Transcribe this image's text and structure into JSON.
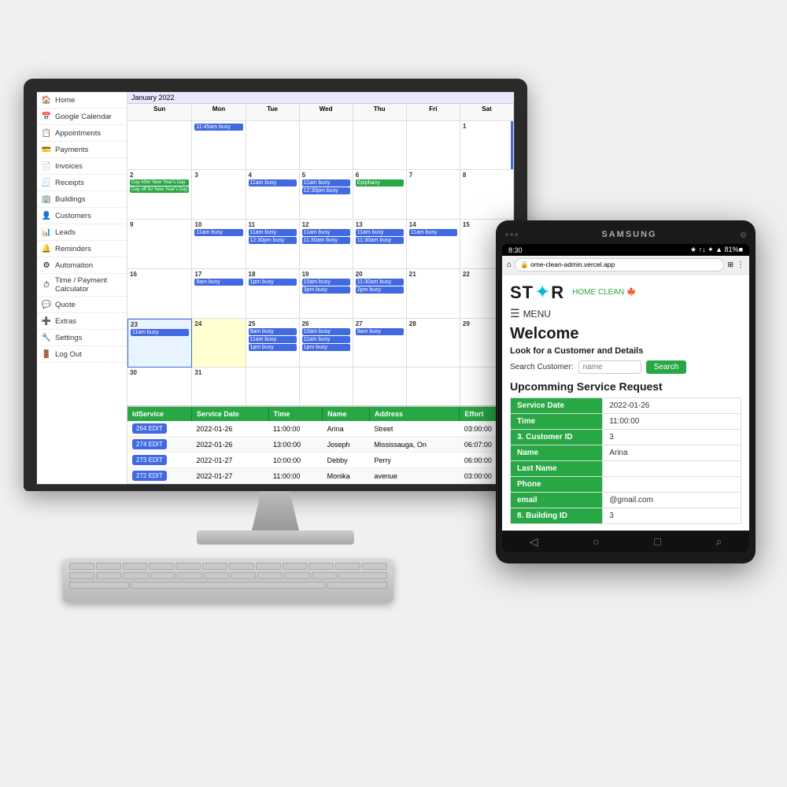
{
  "monitor": {
    "sidebar": {
      "items": [
        {
          "label": "Home",
          "icon": "house"
        },
        {
          "label": "Google Calendar",
          "icon": "calendar"
        },
        {
          "label": "Appointments",
          "icon": "appt"
        },
        {
          "label": "Payments",
          "icon": "payment"
        },
        {
          "label": "Invoices",
          "icon": "invoice"
        },
        {
          "label": "Receipts",
          "icon": "receipt"
        },
        {
          "label": "Buildings",
          "icon": "building"
        },
        {
          "label": "Customers",
          "icon": "customer"
        },
        {
          "label": "Leads",
          "icon": "leads"
        },
        {
          "label": "Reminders",
          "icon": "reminder"
        },
        {
          "label": "Automation",
          "icon": "auto"
        },
        {
          "label": "Time / Payment Calculator",
          "icon": "time"
        },
        {
          "label": "Quote",
          "icon": "quote"
        },
        {
          "label": "Extras",
          "icon": "extras"
        },
        {
          "label": "Settings",
          "icon": "settings"
        },
        {
          "label": "Log Out",
          "icon": "logout"
        }
      ]
    },
    "calendar": {
      "month": "January 2022",
      "headers": [
        "Sun",
        "Mon",
        "Tue",
        "Wed",
        "Thu",
        "Fri",
        "Sat"
      ],
      "rows": [
        [
          {
            "date": "",
            "events": []
          },
          {
            "date": "",
            "events": [
              "11:45am busy"
            ]
          },
          {
            "date": "",
            "events": []
          },
          {
            "date": "",
            "events": []
          },
          {
            "date": "",
            "events": []
          },
          {
            "date": "",
            "events": []
          },
          {
            "date": "1",
            "events": []
          }
        ],
        [
          {
            "date": "2",
            "events": [
              "Day After New Year's Day",
              "Day off for New Year's Day"
            ]
          },
          {
            "date": "3",
            "events": []
          },
          {
            "date": "4",
            "events": [
              "11am busy"
            ]
          },
          {
            "date": "5",
            "events": [
              "11am busy",
              "12:30pm busy"
            ]
          },
          {
            "date": "6",
            "events": [
              "Epiphany"
            ]
          },
          {
            "date": "7",
            "events": []
          },
          {
            "date": "8",
            "events": []
          }
        ],
        [
          {
            "date": "9",
            "events": []
          },
          {
            "date": "10",
            "events": [
              "11am busy"
            ]
          },
          {
            "date": "11",
            "events": [
              "11am busy",
              "12:30pm busy"
            ]
          },
          {
            "date": "12",
            "events": [
              "11am busy",
              "11:30am busy"
            ]
          },
          {
            "date": "13",
            "events": [
              "11am busy",
              "11:30am busy"
            ]
          },
          {
            "date": "14",
            "events": [
              "11am busy"
            ]
          },
          {
            "date": "15",
            "events": []
          }
        ],
        [
          {
            "date": "16",
            "events": []
          },
          {
            "date": "17",
            "events": [
              "9am busy"
            ]
          },
          {
            "date": "18",
            "events": [
              "1pm busy"
            ]
          },
          {
            "date": "19",
            "events": [
              "10am busy",
              "3pm busy"
            ]
          },
          {
            "date": "20",
            "events": [
              "11:30am busy",
              "2pm busy"
            ]
          },
          {
            "date": "21",
            "events": []
          },
          {
            "date": "22",
            "events": []
          }
        ],
        [
          {
            "date": "23",
            "events": [
              "11am busy"
            ],
            "highlight": true
          },
          {
            "date": "24",
            "events": [],
            "today": true
          },
          {
            "date": "25",
            "events": [
              "9am busy",
              "11am busy",
              "1pm busy"
            ]
          },
          {
            "date": "26",
            "events": [
              "10am busy",
              "11am busy",
              "1pm busy"
            ]
          },
          {
            "date": "27",
            "events": [
              "9am busy"
            ]
          },
          {
            "date": "28",
            "events": []
          },
          {
            "date": "29",
            "events": []
          }
        ],
        [
          {
            "date": "30",
            "events": []
          },
          {
            "date": "31",
            "events": []
          },
          {
            "date": "",
            "events": []
          },
          {
            "date": "",
            "events": []
          },
          {
            "date": "",
            "events": []
          },
          {
            "date": "",
            "events": []
          },
          {
            "date": "",
            "events": []
          }
        ]
      ]
    },
    "table": {
      "headers": [
        "IdService",
        "Service Date",
        "Time",
        "Name",
        "Address",
        "Effort"
      ],
      "rows": [
        {
          "id": "264",
          "date": "2022-01-26",
          "time": "11:00:00",
          "name": "Arina",
          "address": "Street",
          "effort": "03:00:00"
        },
        {
          "id": "274",
          "date": "2022-01-26",
          "time": "13:00:00",
          "name": "Joseph",
          "address": "Mississauga, On",
          "effort": "06:07:00"
        },
        {
          "id": "273",
          "date": "2022-01-27",
          "time": "10:00:00",
          "name": "Debby",
          "address": "Perry",
          "effort": "06:00:00"
        },
        {
          "id": "272",
          "date": "2022-01-27",
          "time": "11:00:00",
          "name": "Monika",
          "address": "avenue",
          "effort": "03:00:00"
        }
      ]
    }
  },
  "tablet": {
    "samsung_label": "SAMSUNG",
    "status_bar": {
      "time": "8:30",
      "icons": "★ ↑↓ ✦ ▲ 81%■"
    },
    "url": "ome-clean-admin.vercel.app",
    "logo": {
      "prefix": "ST",
      "star": "✦",
      "suffix": "R",
      "tagline": "HOME CLEAN"
    },
    "menu_label": "MENU",
    "welcome_title": "Welcome",
    "subtitle": "Look for a Customer and Details",
    "search": {
      "label": "Search Customer:",
      "placeholder": "name",
      "button_label": "Search"
    },
    "section_title": "Upcomming Service Request",
    "service_info": [
      {
        "label": "Service Date",
        "value": "2022-01-26"
      },
      {
        "label": "Time",
        "value": "11:00:00"
      },
      {
        "label": "3. Customer ID",
        "value": "3"
      },
      {
        "label": "Name",
        "value": "Arina"
      },
      {
        "label": "Last Name",
        "value": ""
      },
      {
        "label": "Phone",
        "value": ""
      },
      {
        "label": "email",
        "value": "@gmail.com"
      },
      {
        "label": "8. Building ID",
        "value": "3"
      }
    ]
  }
}
